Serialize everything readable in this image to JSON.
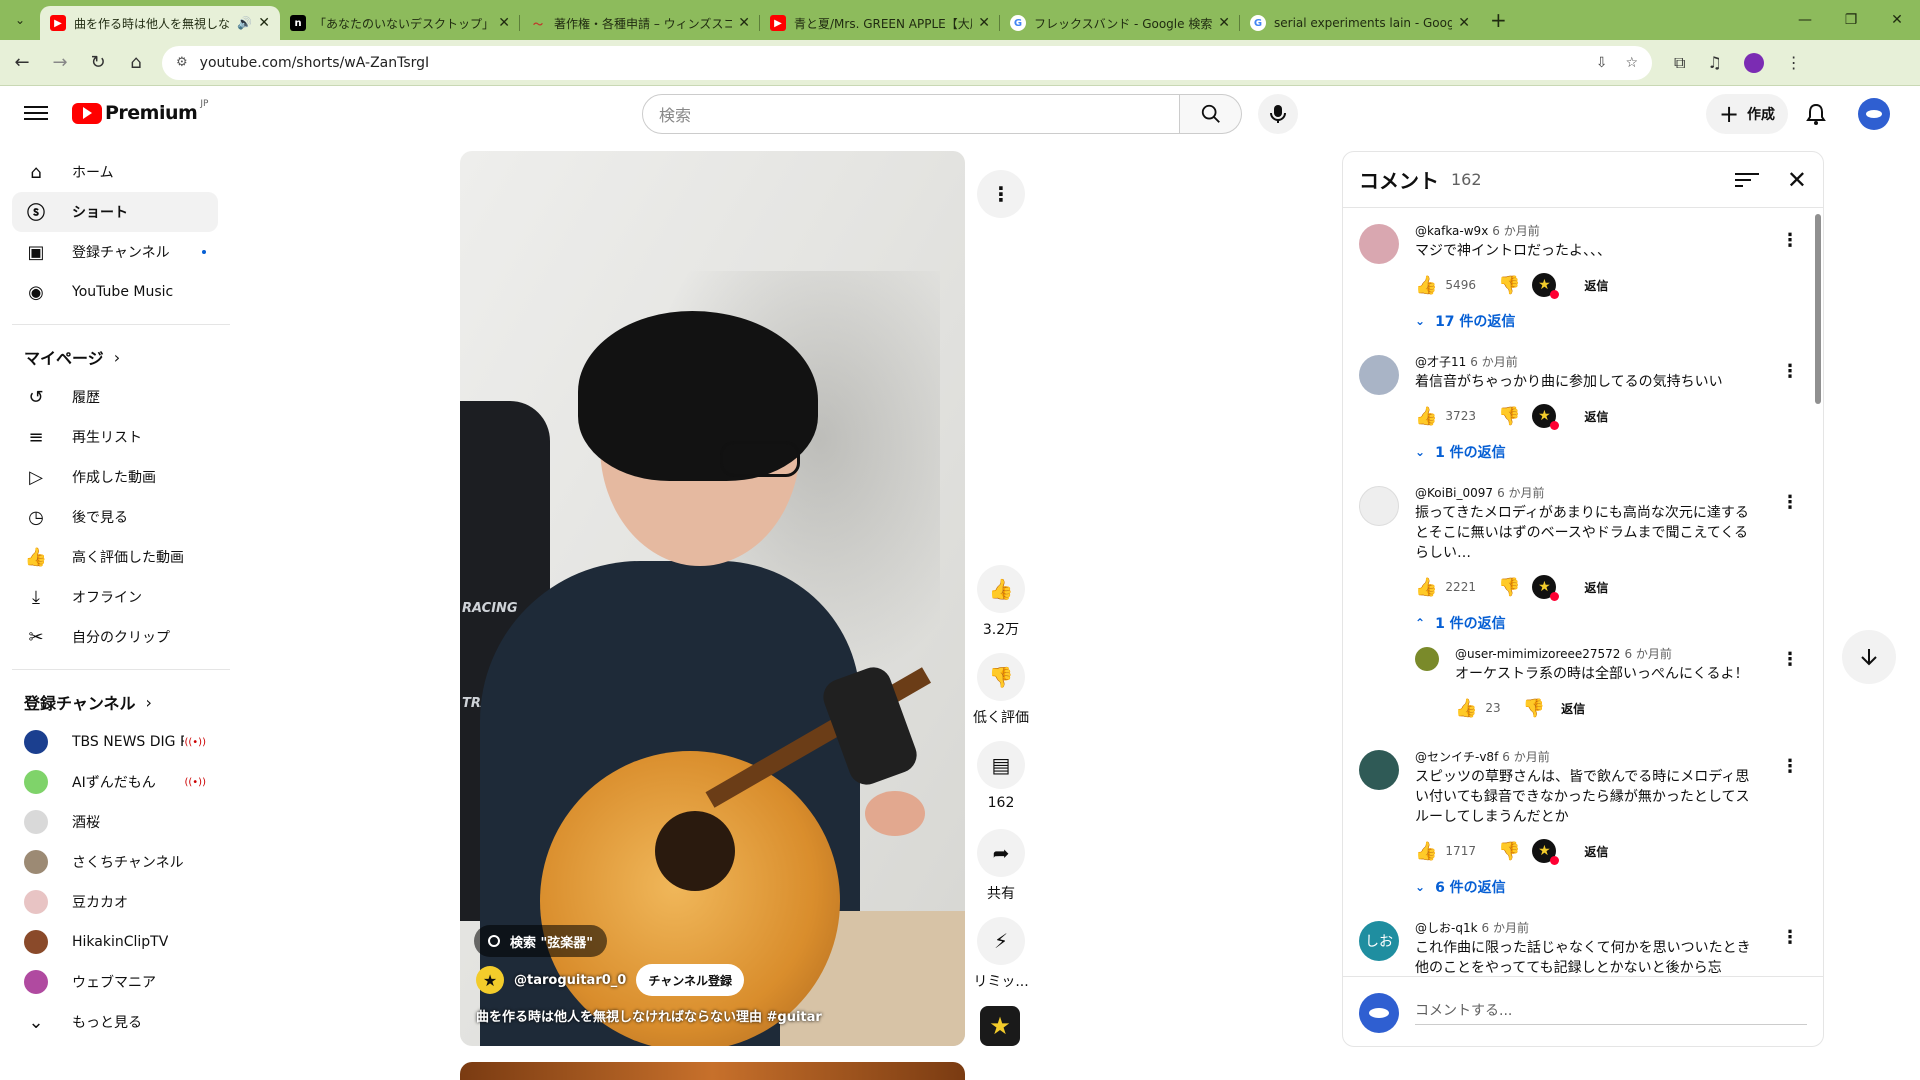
{
  "browser": {
    "tabs": [
      {
        "title": "曲を作る時は他人を無視しなければならない理由 #guitar - YouTube",
        "icon": "youtube-favicon",
        "active": true
      },
      {
        "title": "「あなたのいないデスクトップ」について",
        "icon": "note-favicon",
        "active": false
      },
      {
        "title": "著作権・各種申請 – ウィンズスコア",
        "icon": "winds-favicon",
        "active": false
      },
      {
        "title": "青と夏/Mrs. GREEN APPLE【大原",
        "icon": "youtube-favicon",
        "active": false
      },
      {
        "title": "フレックスバンド - Google 検索",
        "icon": "google-favicon",
        "active": false
      },
      {
        "title": "serial experiments lain - Google",
        "icon": "google-favicon",
        "active": false
      }
    ],
    "url": "youtube.com/shorts/wA-ZanTsrgI",
    "accent": "#8dbb5c"
  },
  "header": {
    "logo_text": "Premium",
    "region": "JP",
    "search_placeholder": "検索",
    "create_label": "作成"
  },
  "sidebar": {
    "main": [
      {
        "label": "ホーム",
        "icon": "home-icon"
      },
      {
        "label": "ショート",
        "icon": "shorts-icon",
        "active": true
      },
      {
        "label": "登録チャンネル",
        "icon": "subscriptions-icon",
        "dot": true
      },
      {
        "label": "YouTube Music",
        "icon": "music-icon"
      }
    ],
    "my_page_title": "マイページ",
    "my_page": [
      {
        "label": "履歴",
        "icon": "history-icon"
      },
      {
        "label": "再生リスト",
        "icon": "playlist-icon"
      },
      {
        "label": "作成した動画",
        "icon": "your-videos-icon"
      },
      {
        "label": "後で見る",
        "icon": "watch-later-icon"
      },
      {
        "label": "高く評価した動画",
        "icon": "liked-icon"
      },
      {
        "label": "オフライン",
        "icon": "download-icon"
      },
      {
        "label": "自分のクリップ",
        "icon": "clip-icon"
      }
    ],
    "subs_title": "登録チャンネル",
    "subs": [
      {
        "label": "TBS NEWS DIG P...",
        "live": true,
        "color": "#1b3f8f"
      },
      {
        "label": "AIずんだもん",
        "live": true,
        "color": "#7fd36a"
      },
      {
        "label": "酒桜",
        "live": false,
        "color": "#d9d9d9"
      },
      {
        "label": "さくちチャンネル",
        "live": false,
        "color": "#9c8a74"
      },
      {
        "label": "豆カカオ",
        "live": false,
        "color": "#e8c4c4"
      },
      {
        "label": "HikakinClipTV",
        "live": false,
        "color": "#8a4a2a"
      },
      {
        "label": "ウェブマニア",
        "live": false,
        "color": "#b04aa0"
      }
    ],
    "more_label": "もっと見る"
  },
  "video": {
    "search_chip": "検索 \"弦楽器\"",
    "channel": "@taroguitar0_0",
    "subscribe_label": "チャンネル登録",
    "title": "曲を作る時は他人を無視しなければならない理由 #guitar",
    "overlay_text_1": "RACING",
    "overlay_text_2": "TRAC"
  },
  "actions": {
    "like": "3.2万",
    "dislike": "低く評価",
    "comments": "162",
    "share": "共有",
    "remix": "リミッ..."
  },
  "comments": {
    "title": "コメント",
    "count": "162",
    "input_placeholder": "コメントする...",
    "reply_label": "返信",
    "items": [
      {
        "author": "@kafka-w9x",
        "time": "6 か月前",
        "text": "マジで神イントロだったよ、、、",
        "likes": "5496",
        "replies": "17 件の返信",
        "avatar": "#d9a7b0"
      },
      {
        "author": "@才子11",
        "time": "6 か月前",
        "text": "着信音がちゃっかり曲に参加してるの気持ちいい",
        "likes": "3723",
        "replies": "1 件の返信",
        "avatar": "#a9b4c6"
      },
      {
        "author": "@KoiBi_0097",
        "time": "6 か月前",
        "text": "振ってきたメロディがあまりにも高尚な次元に達するとそこに無いはずのベースやドラムまで聞こえてくるらしい…",
        "likes": "2221",
        "replies": "1 件の返信",
        "avatar": "#eeeeee",
        "reply": {
          "author": "@user-mimimizoreee27572",
          "time": "6 か月前",
          "text": "オーケストラ系の時は全部いっぺんにくるよ！",
          "likes": "23"
        }
      },
      {
        "author": "@センイチ-v8f",
        "time": "6 か月前",
        "text": "スピッツの草野さんは、皆で飲んでる時にメロディ思い付いても録音できなかったら縁が無かったとしてスルーしてしまうんだとか",
        "likes": "1717",
        "replies": "6 件の返信",
        "avatar": "#2f5a56"
      },
      {
        "author": "@しお-q1k",
        "time": "6 か月前",
        "text": "これ作曲に限った話じゃなくて何かを思いついたとき他のことをやってても記録しとかないと後から忘",
        "likes": "",
        "replies": "",
        "avatar": "#1f8ea0",
        "avatar_text": "しお"
      }
    ]
  }
}
